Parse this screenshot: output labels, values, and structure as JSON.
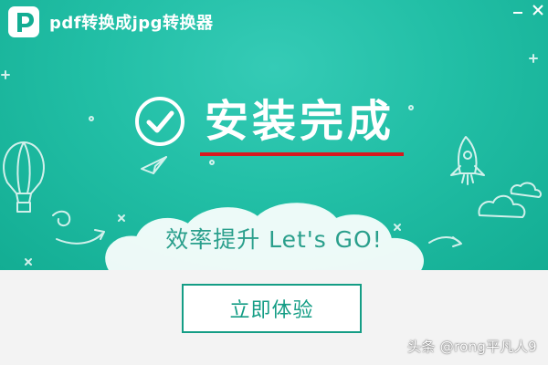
{
  "window": {
    "title": "pdf转换成jpg转换器",
    "controls": {
      "minimize_icon": "minimize-icon",
      "close_icon": "close-icon"
    }
  },
  "banner": {
    "status_text": "安装完成",
    "slogan": "效率提升 Let's GO!",
    "check_icon": "check-circle-icon"
  },
  "actions": {
    "start_button": "立即体验"
  },
  "watermark": {
    "text": "头条 @rong平凡人9"
  },
  "colors": {
    "banner_background": "#22bfa6",
    "accent_red": "#d7191f",
    "button_text": "#149d85",
    "footer_background": "#f3f3f3"
  }
}
